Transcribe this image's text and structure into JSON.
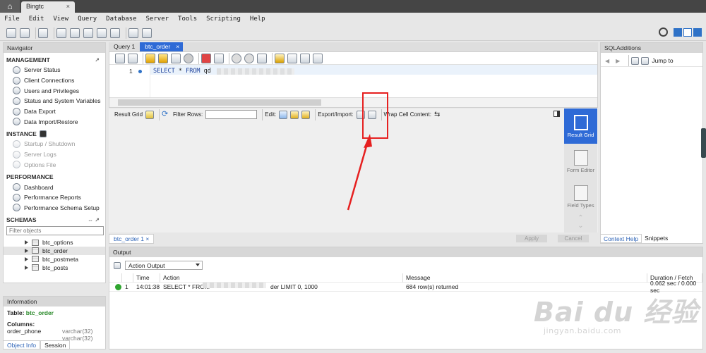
{
  "window": {
    "home_icon": "house-icon",
    "connection_tab": "Bingtc",
    "close_glyph": "×"
  },
  "menu": [
    "File",
    "Edit",
    "View",
    "Query",
    "Database",
    "Server",
    "Tools",
    "Scripting",
    "Help"
  ],
  "navigator": {
    "title": "Navigator",
    "management": {
      "heading": "MANAGEMENT",
      "items": [
        "Server Status",
        "Client Connections",
        "Users and Privileges",
        "Status and System Variables",
        "Data Export",
        "Data Import/Restore"
      ]
    },
    "instance": {
      "heading": "INSTANCE",
      "items": [
        "Startup / Shutdown",
        "Server Logs",
        "Options File"
      ]
    },
    "performance": {
      "heading": "PERFORMANCE",
      "items": [
        "Dashboard",
        "Performance Reports",
        "Performance Schema Setup"
      ]
    },
    "schemas": {
      "heading": "SCHEMAS",
      "filter_placeholder": "Filter objects",
      "items": [
        "btc_options",
        "btc_order",
        "btc_postmeta",
        "btc_posts"
      ],
      "selected": "btc_order"
    }
  },
  "information": {
    "title": "Information",
    "table_label": "Table:",
    "table_name": "btc_order",
    "columns_label": "Columns:",
    "columns": [
      {
        "name": "order_phone",
        "type": "varchar(32)"
      },
      {
        "name": "",
        "type": "varchar(32)"
      }
    ],
    "tabs": [
      "Object Info",
      "Session"
    ]
  },
  "query_tabs": [
    "Query 1",
    "btc_order"
  ],
  "editor": {
    "line_number": "1",
    "sql_keyword1": "SELECT",
    "sql_rest": " * ",
    "sql_keyword2": "FROM",
    "sql_visible_tail": " qd"
  },
  "result_toolbar": {
    "result_grid": "Result Grid",
    "filter_rows": "Filter Rows:",
    "edit": "Edit:",
    "export_import": "Export/Import:",
    "wrap_cell": "Wrap Cell Content:"
  },
  "side_rail": [
    "Result Grid",
    "Form Editor",
    "Field Types"
  ],
  "result_tab": "btc_order 1",
  "buttons": {
    "apply": "Apply",
    "revert": "Cancel"
  },
  "output": {
    "title": "Output",
    "mode": "Action Output",
    "headers": [
      "",
      "",
      "Time",
      "Action",
      "Message",
      "Duration / Fetch"
    ],
    "rows": [
      {
        "index": "1",
        "time": "14:01:38",
        "action_start": "SELECT * FROM",
        "action_end": "der LIMIT 0, 1000",
        "message": "684 row(s) returned",
        "duration": "0.062 sec / 0.000 sec"
      }
    ]
  },
  "sql_additions": {
    "title": "SQLAdditions",
    "jump_to": "Jump to",
    "tabs": [
      "Context Help",
      "Snippets"
    ]
  },
  "watermark": {
    "main": "Bai du 经验",
    "sub": "jingyan.baidu.com"
  },
  "colors": {
    "accent": "#2e6ad6",
    "highlight": "#e62020",
    "success": "#2fa52f"
  }
}
